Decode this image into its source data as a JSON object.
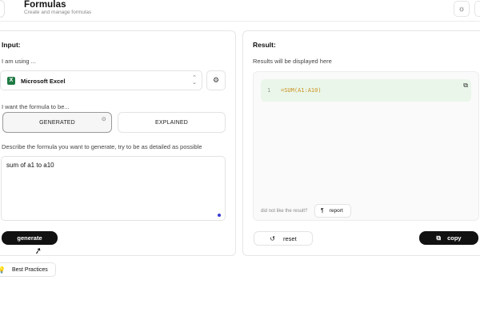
{
  "header": {
    "title": "Formulas",
    "subtitle": "Create and manage formulas",
    "theme_icon": "sun-icon"
  },
  "input": {
    "heading": "Input:",
    "using_label": "I am using ...",
    "app_selected": "Microsoft Excel",
    "app_icon": "excel-icon",
    "want_label": "I want the formula to be...",
    "modes": [
      {
        "label": "GENERATED",
        "selected": true
      },
      {
        "label": "EXPLAINED",
        "selected": false
      }
    ],
    "describe_label": "Describe the formula you want to generate, try to be as detailed as possible",
    "textarea_value": "sum of a1 to a10",
    "generate_label": "generate"
  },
  "best_practices_label": "Best Practices",
  "result": {
    "heading": "Result:",
    "placeholder_label": "Results will be displayed here",
    "line_number": "1",
    "formula": "=SUM(A1:A10)",
    "dislike_text": "did not like the result?",
    "report_label": "report",
    "reset_label": "reset",
    "copy_label": "copy"
  },
  "colors": {
    "accent_dark": "#111111",
    "code_bg": "#eaf6ea",
    "formula_text": "#c9921e",
    "excel_green": "#1f7a43"
  }
}
